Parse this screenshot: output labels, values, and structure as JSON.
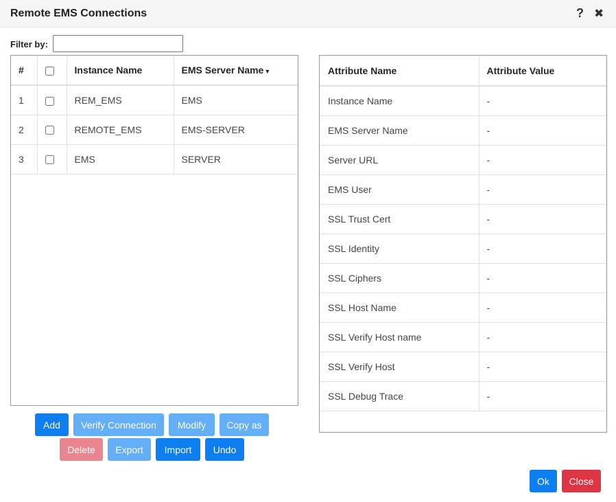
{
  "dialog": {
    "title": "Remote EMS Connections",
    "help_glyph": "?",
    "close_glyph": "✖"
  },
  "filter": {
    "label": "Filter by:",
    "value": "",
    "placeholder": ""
  },
  "connections": {
    "headers": {
      "num": "#",
      "instance": "Instance Name",
      "server": "EMS Server Name",
      "sort_glyph": "▼"
    },
    "rows": [
      {
        "num": "1",
        "instance": "REM_EMS",
        "server": "EMS",
        "checked": false
      },
      {
        "num": "2",
        "instance": "REMOTE_EMS",
        "server": "EMS-SERVER",
        "checked": false
      },
      {
        "num": "3",
        "instance": "EMS",
        "server": "SERVER",
        "checked": false
      }
    ]
  },
  "attributes": {
    "headers": {
      "name": "Attribute Name",
      "value": "Attribute Value"
    },
    "rows": [
      {
        "name": "Instance Name",
        "value": "-"
      },
      {
        "name": "EMS Server Name",
        "value": "-"
      },
      {
        "name": "Server URL",
        "value": "-"
      },
      {
        "name": "EMS User",
        "value": "-"
      },
      {
        "name": "SSL Trust Cert",
        "value": "-"
      },
      {
        "name": "SSL Identity",
        "value": "-"
      },
      {
        "name": "SSL Ciphers",
        "value": "-"
      },
      {
        "name": "SSL Host Name",
        "value": "-"
      },
      {
        "name": "SSL Verify Host name",
        "value": "-"
      },
      {
        "name": "SSL Verify Host",
        "value": "-"
      },
      {
        "name": "SSL Debug Trace",
        "value": "-"
      }
    ]
  },
  "actions": {
    "add": "Add",
    "verify": "Verify Connection",
    "modify": "Modify",
    "copy_as": "Copy as",
    "delete": "Delete",
    "export": "Export",
    "import": "Import",
    "undo": "Undo"
  },
  "footer": {
    "ok": "Ok",
    "close": "Close"
  },
  "colors": {
    "primary": "#0d7ef0",
    "primary_disabled": "#62aef7",
    "danger": "#dc3545",
    "danger_disabled": "#e8858e"
  }
}
